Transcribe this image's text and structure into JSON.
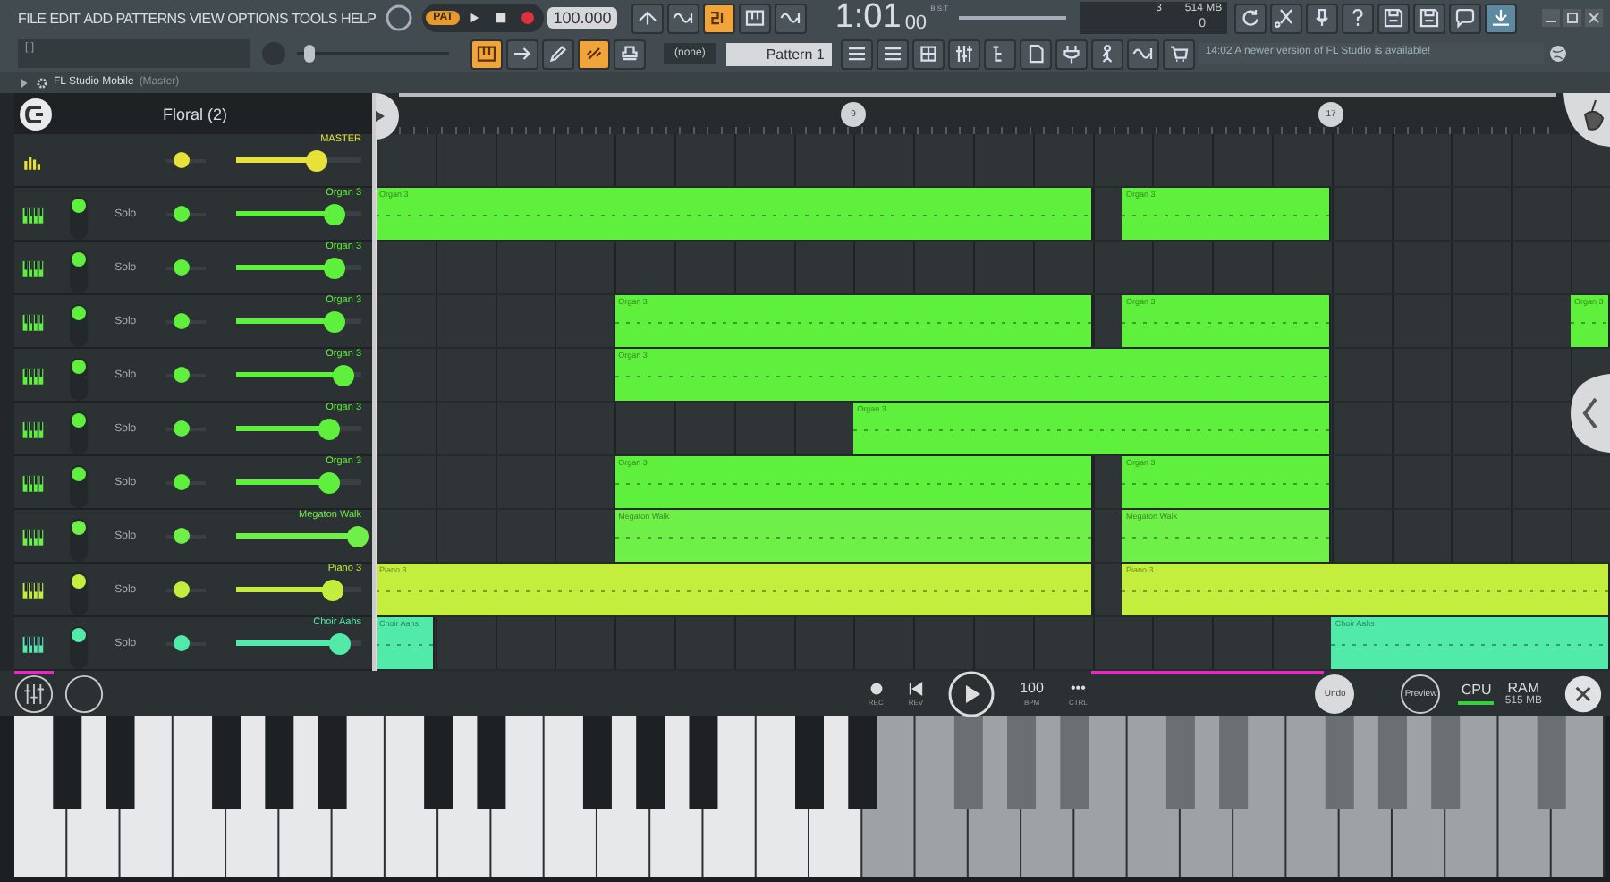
{
  "menu": [
    "FILE",
    "EDIT",
    "ADD",
    "PATTERNS",
    "VIEW",
    "OPTIONS",
    "TOOLS",
    "HELP"
  ],
  "transport": {
    "mode_badge": "PAT",
    "tempo": "100.000",
    "time": "1:01",
    "time_small": "00",
    "time_unit": "B:S:T"
  },
  "toolbar_row1": [
    {
      "kind": "arrowup",
      "on": false
    },
    {
      "kind": "wave",
      "on": false
    },
    {
      "kind": "count",
      "on": true
    },
    {
      "kind": "keys",
      "on": false
    },
    {
      "kind": "wave",
      "on": false
    }
  ],
  "monitor": {
    "value_1": "3",
    "memory": "514 MB",
    "value_2": "0"
  },
  "toolbar_right": [
    {
      "kind": "refresh",
      "on": false
    },
    {
      "kind": "scissors",
      "on": false
    },
    {
      "kind": "mic",
      "on": false
    },
    {
      "kind": "help",
      "on": false
    },
    {
      "kind": "disk",
      "on": false
    },
    {
      "kind": "disk",
      "on": false
    },
    {
      "kind": "chat",
      "on": false
    },
    {
      "kind": "download",
      "on": true
    }
  ],
  "hint_bar": {
    "text": "[ ]"
  },
  "master_pitch": {
    "level": 0.05
  },
  "toolbar_row2": [
    {
      "kind": "keys",
      "on": true
    },
    {
      "kind": "arrowright",
      "on": false
    },
    {
      "kind": "pencil",
      "on": false
    },
    {
      "kind": "link",
      "on": true
    },
    {
      "kind": "stamp",
      "on": false
    }
  ],
  "pattern": {
    "channel": "(none)",
    "name": "Pattern 1"
  },
  "toolbar_row2b": [
    {
      "kind": "bars",
      "on": false
    },
    {
      "kind": "bars",
      "on": false
    },
    {
      "kind": "grid",
      "on": false
    },
    {
      "kind": "mixer",
      "on": false
    },
    {
      "kind": "tree",
      "on": false
    },
    {
      "kind": "page",
      "on": false
    },
    {
      "kind": "plug",
      "on": false
    },
    {
      "kind": "person",
      "on": false
    },
    {
      "kind": "wave",
      "on": false
    },
    {
      "kind": "cart",
      "on": false
    }
  ],
  "news": {
    "time": "14:02",
    "text": "A newer version of FL Studio is available!"
  },
  "plugin_window": {
    "title": "FL Studio Mobile",
    "subtitle": "(Master)"
  },
  "project": {
    "title": "Floral (2)"
  },
  "ruler": {
    "markers": [
      {
        "label": "9",
        "position": {
          "level": 0.387
        }
      },
      {
        "label": "17",
        "position": {
          "level": 0.774
        }
      }
    ]
  },
  "tracks": [
    {
      "kind": "master",
      "name": "MASTER",
      "color": "#e6e23a",
      "level": 0.65,
      "pan": {
        "level": 0.35
      }
    },
    {
      "kind": "instrument",
      "name": "Organ 3",
      "solo": "Solo",
      "muted": false,
      "color": "#5ef03c",
      "level": 0.79,
      "pan": {
        "level": 0.35
      },
      "clips": [
        {
          "label": "Organ 3"
        },
        {
          "label": "Organ 3"
        }
      ]
    },
    {
      "kind": "instrument",
      "name": "Organ 3",
      "solo": "Solo",
      "muted": false,
      "color": "#5ef03c",
      "level": 0.79,
      "pan": {
        "level": 0.35
      }
    },
    {
      "kind": "instrument",
      "name": "Organ 3",
      "solo": "Solo",
      "muted": false,
      "color": "#5ef03c",
      "level": 0.78,
      "pan": {
        "level": 0.35
      },
      "clips": [
        {
          "label": "Organ 3"
        },
        {
          "label": "Organ 3"
        },
        {
          "label": "Organ 3"
        }
      ]
    },
    {
      "kind": "instrument",
      "name": "Organ 3",
      "solo": "Solo",
      "muted": false,
      "color": "#5ef03c",
      "level": 0.86,
      "pan": {
        "level": 0.35
      },
      "clips": [
        {
          "label": "Organ 3"
        }
      ]
    },
    {
      "kind": "instrument",
      "name": "Organ 3",
      "solo": "Solo",
      "muted": false,
      "color": "#5ef03c",
      "level": 0.75,
      "pan": {
        "level": 0.35
      },
      "clips": [
        {
          "label": "Organ 3"
        }
      ]
    },
    {
      "kind": "instrument",
      "name": "Organ 3",
      "solo": "Solo",
      "muted": false,
      "color": "#5ef03c",
      "level": 0.75,
      "pan": {
        "level": 0.35
      },
      "clips": [
        {
          "label": "Organ 3"
        },
        {
          "label": "Organ 3"
        }
      ]
    },
    {
      "kind": "instrument",
      "name": "Megaton Walk",
      "solo": "Solo",
      "muted": false,
      "color": "#6ef048",
      "level": 0.97,
      "pan": {
        "level": 0.35
      },
      "clips": [
        {
          "label": "Megaton Walk"
        },
        {
          "label": "Megaton Walk"
        }
      ]
    },
    {
      "kind": "instrument",
      "name": "Piano 3",
      "solo": "Solo",
      "muted": false,
      "color": "#c4ee3e",
      "level": 0.77,
      "pan": {
        "level": 0.35
      },
      "clips": [
        {
          "label": "Piano 3"
        },
        {
          "label": "Piano 3"
        }
      ]
    },
    {
      "kind": "instrument",
      "name": "Choir Aahs",
      "solo": "Solo",
      "muted": false,
      "color": "#52eaa8",
      "level": 0.83,
      "pan": {
        "level": 0.35
      },
      "clips": [
        {
          "label": "Choir Aahs"
        },
        {
          "label": "Choir Aahs"
        }
      ]
    }
  ],
  "controls": {
    "rec": "REC",
    "rev": "REV",
    "tempo": "100",
    "tempo_unit": "BPM",
    "more": "•••",
    "more_label": "CTRL",
    "undo": "Undo",
    "preview": "Preview",
    "cpu": "CPU",
    "ram": "RAM",
    "ram_value": "515 MB"
  },
  "keyboard": {
    "white_keys": [
      {
        "disabled": false
      },
      {
        "disabled": false
      },
      {
        "disabled": false
      },
      {
        "disabled": false
      },
      {
        "disabled": false
      },
      {
        "disabled": false
      },
      {
        "disabled": false
      },
      {
        "disabled": false
      },
      {
        "disabled": false
      },
      {
        "disabled": false
      },
      {
        "disabled": false
      },
      {
        "disabled": false
      },
      {
        "disabled": false
      },
      {
        "disabled": false
      },
      {
        "disabled": false
      },
      {
        "disabled": false
      },
      {
        "disabled": true
      },
      {
        "disabled": true
      },
      {
        "disabled": true
      },
      {
        "disabled": true
      },
      {
        "disabled": true
      },
      {
        "disabled": true
      },
      {
        "disabled": true
      },
      {
        "disabled": true
      },
      {
        "disabled": true
      },
      {
        "disabled": true
      },
      {
        "disabled": true
      },
      {
        "disabled": true
      },
      {
        "disabled": true
      },
      {
        "disabled": true
      }
    ]
  }
}
